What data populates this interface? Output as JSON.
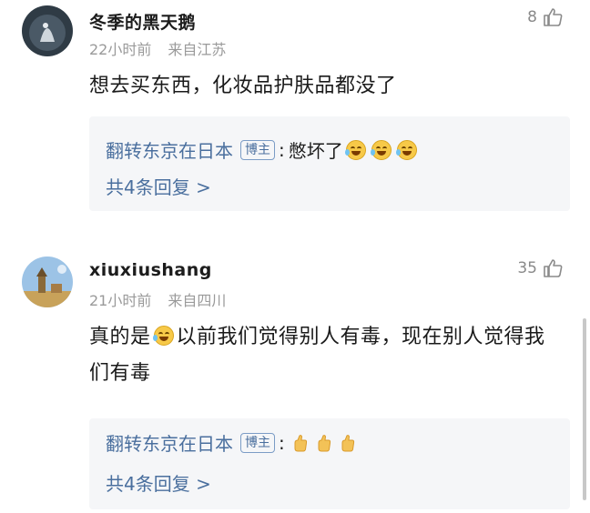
{
  "comments": [
    {
      "username": "冬季的黑天鹅",
      "time": "22小时前",
      "location": "来自江苏",
      "likes": "8",
      "text": "想去买东西，化妆品护肤品都没了",
      "reply": {
        "author": "翻转东京在日本",
        "badge": "博主",
        "separator": ":",
        "text": "憋坏了",
        "emojis": [
          "laugh-cry-emoji",
          "laugh-cry-emoji",
          "laugh-cry-emoji"
        ],
        "count_label": "共4条回复 >"
      }
    },
    {
      "username": "xiuxiushang",
      "time": "21小时前",
      "location": "来自四川",
      "likes": "35",
      "text_before": "真的是",
      "text_after": "以前我们觉得别人有毒，现在别人觉得我们有毒",
      "reply": {
        "author": "翻转东京在日本",
        "badge": "博主",
        "separator": ":",
        "emojis": [
          "thumbs-up-emoji",
          "thumbs-up-emoji",
          "thumbs-up-emoji"
        ],
        "count_label": "共4条回复 >"
      }
    }
  ],
  "colors": {
    "link": "#4a6f9e",
    "reply_bg": "#f5f6f8",
    "meta": "#9a9a9a"
  }
}
